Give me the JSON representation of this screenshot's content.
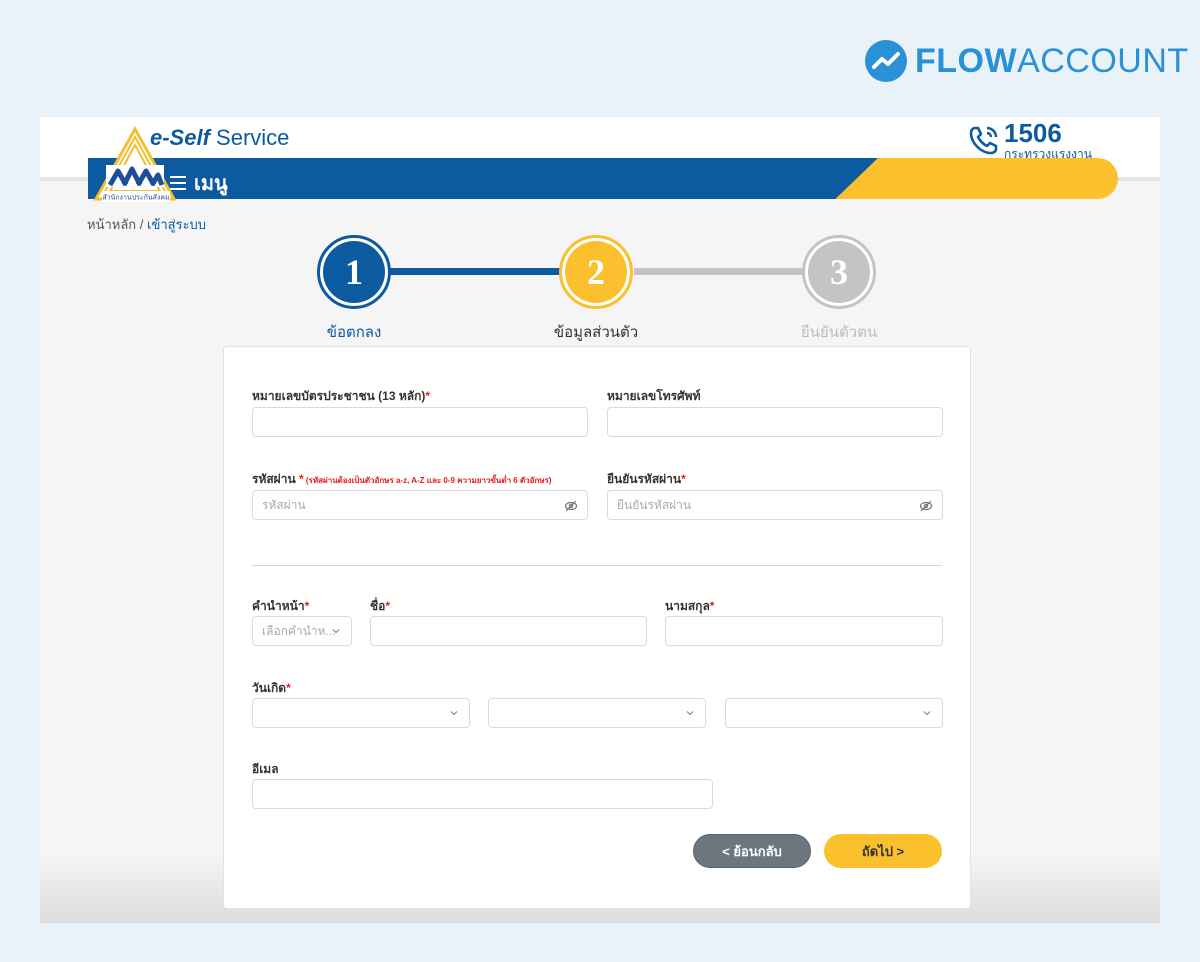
{
  "brand": {
    "name_bold": "FLOW",
    "name_light": "ACCOUNT",
    "color": "#2a91d6"
  },
  "header": {
    "title_bold": "e-Self",
    "title_rest": " Service",
    "logo_caption": "สำนักงานประกันสังคม",
    "hotline_number": "1506",
    "hotline_sub": "กระทรวงแรงงาน",
    "menu_label": "เมนู",
    "primary_color": "#0c5aa0",
    "accent_color": "#fbc02d"
  },
  "breadcrumb": {
    "home": "หน้าหลัก",
    "separator": " / ",
    "current": "เข้าสู่ระบบ"
  },
  "steps": [
    {
      "number": "1",
      "label": "ข้อตกลง",
      "state": "completed"
    },
    {
      "number": "2",
      "label": "ข้อมูลส่วนตัว",
      "state": "active"
    },
    {
      "number": "3",
      "label": "ยืนยันตัวตน",
      "state": "pending"
    }
  ],
  "form": {
    "id_card": {
      "label": "หมายเลขบัตรประชาชน (13 หลัก)",
      "required": "*",
      "value": "",
      "placeholder": ""
    },
    "phone": {
      "label": "หมายเลขโทรศัพท์",
      "value": "",
      "placeholder": ""
    },
    "password": {
      "label": "รหัสผ่าน",
      "required": "*",
      "hint": " (รหัสผ่านต้องเป็นตัวอักษร a-z, A-Z และ 0-9 ความยาวขั้นต่ำ 6 ตัวอักษร)",
      "placeholder": "รหัสผ่าน"
    },
    "confirm_password": {
      "label": "ยืนยันรหัสผ่าน",
      "required": "*",
      "placeholder": "ยืนยันรหัสผ่าน"
    },
    "title": {
      "label": "คำนำหน้า",
      "required": "*",
      "selected": "เลือกคำนำห..."
    },
    "first_name": {
      "label": "ชื่อ",
      "required": "*",
      "value": ""
    },
    "last_name": {
      "label": "นามสกุล",
      "required": "*",
      "value": ""
    },
    "birthdate": {
      "label": "วันเกิด",
      "required": "*",
      "day": "",
      "month": "",
      "year": ""
    },
    "email": {
      "label": "อีเมล",
      "value": ""
    }
  },
  "buttons": {
    "back": "< ย้อนกลับ",
    "next": "ถัดไป >"
  }
}
